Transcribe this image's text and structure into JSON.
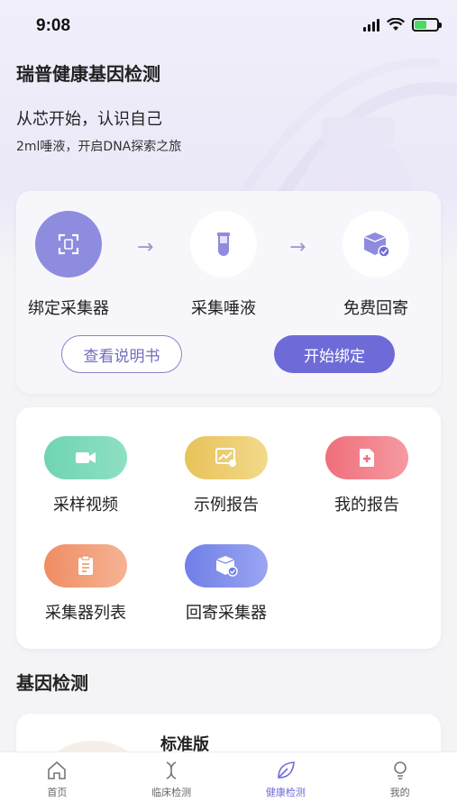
{
  "status": {
    "time": "9:08"
  },
  "hero": {
    "title": "瑞普健康基因检测",
    "subtitle": "从芯开始，认识自己",
    "tagline": "2ml唾液，开启DNA探索之旅"
  },
  "steps": [
    {
      "label": "绑定采集器",
      "icon": "scan-icon"
    },
    {
      "label": "采集唾液",
      "icon": "test-tube-icon"
    },
    {
      "label": "免费回寄",
      "icon": "package-check-icon"
    }
  ],
  "actions": {
    "manual": "查看说明书",
    "bind": "开始绑定"
  },
  "menu": [
    {
      "label": "采样视频",
      "icon": "video-icon",
      "color_from": "#6fd4b3",
      "color_to": "#8ee0c2"
    },
    {
      "label": "示例报告",
      "icon": "chart-report-icon",
      "color_from": "#e8c25a",
      "color_to": "#f2d98a"
    },
    {
      "label": "我的报告",
      "icon": "medical-report-icon",
      "color_from": "#ee6f7b",
      "color_to": "#f59aa1"
    },
    {
      "label": "采集器列表",
      "icon": "clipboard-icon",
      "color_from": "#ef8d63",
      "color_to": "#f6b394"
    },
    {
      "label": "回寄采集器",
      "icon": "package-return-icon",
      "color_from": "#6f7fe6",
      "color_to": "#9aa5f2"
    }
  ],
  "section": {
    "title": "基因检测"
  },
  "product": {
    "name": "标准版"
  },
  "tabs": [
    {
      "label": "首页",
      "icon": "home-icon"
    },
    {
      "label": "临床检测",
      "icon": "dna-icon"
    },
    {
      "label": "健康检测",
      "icon": "leaf-icon",
      "active": true
    },
    {
      "label": "我的",
      "icon": "user-icon"
    }
  ],
  "colors": {
    "accent": "#6e6bd8",
    "step_active": "#8e8cdf"
  }
}
